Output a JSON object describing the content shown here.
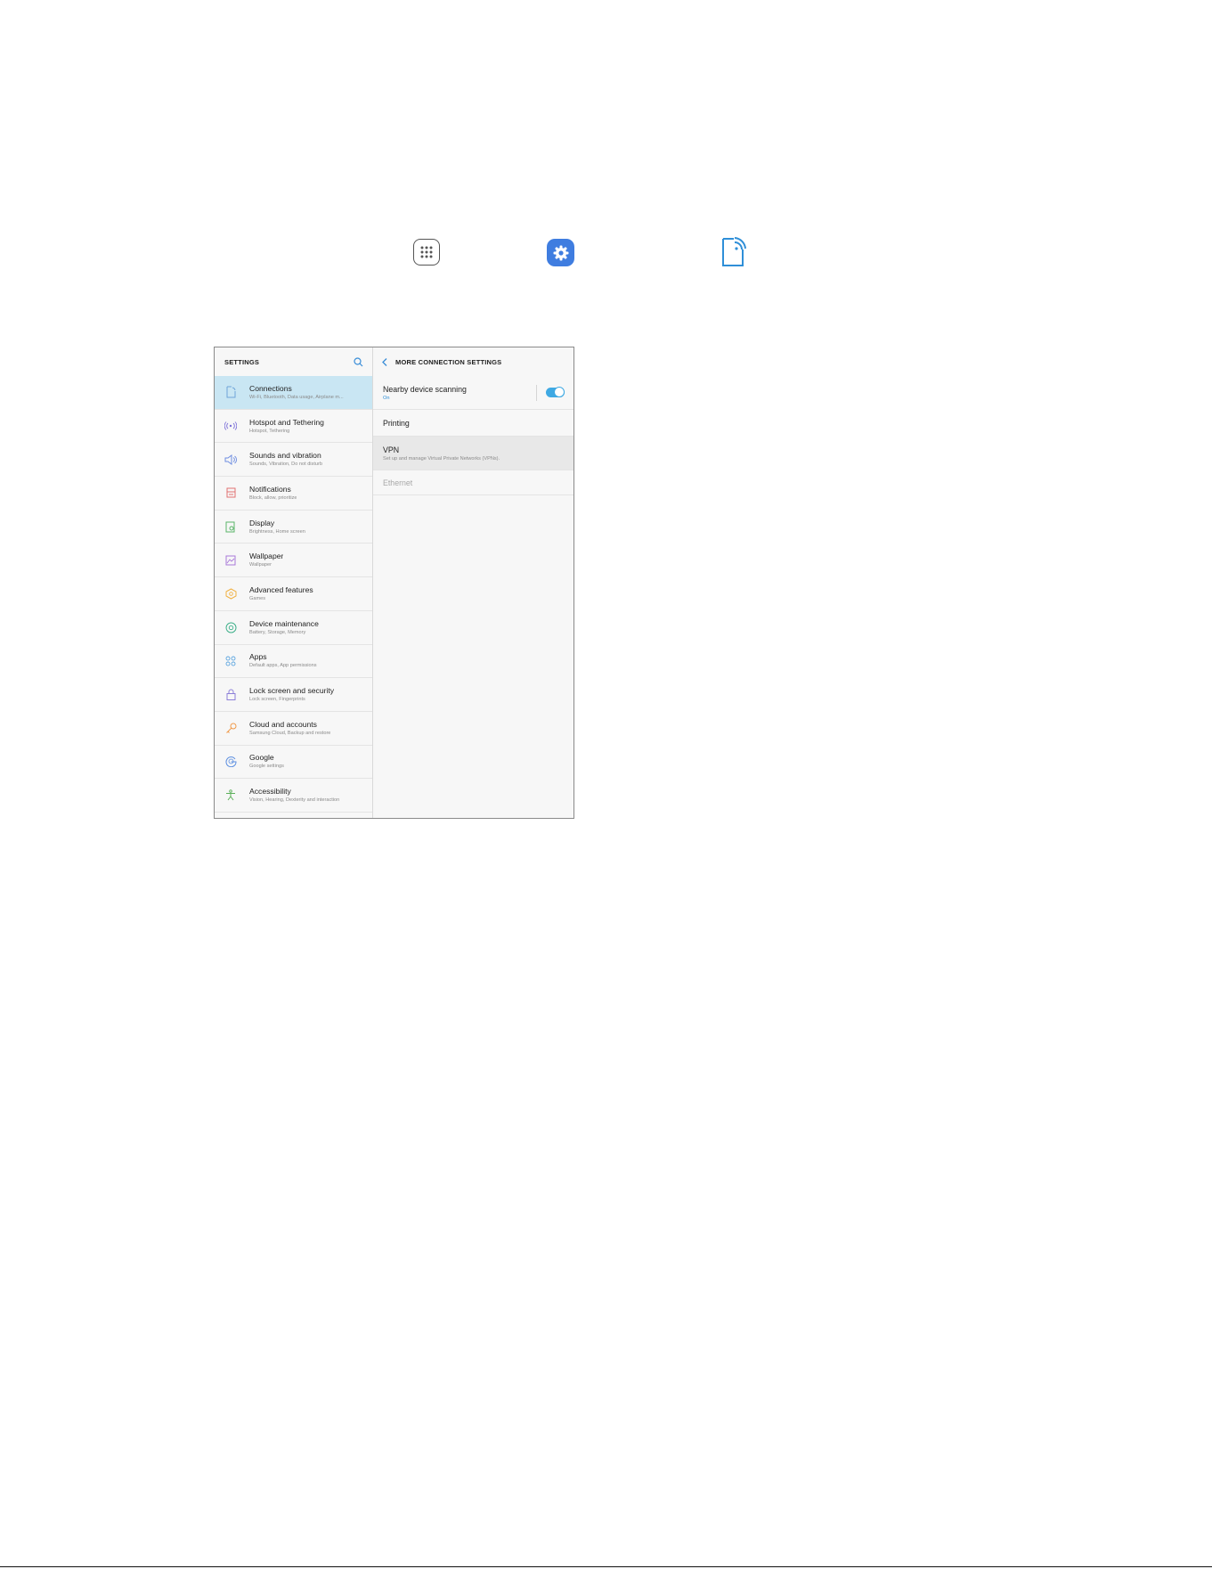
{
  "left_pane": {
    "header_title": "SETTINGS",
    "items": [
      {
        "title": "Connections",
        "subtitle": "Wi-Fi, Bluetooth, Data usage, Airplane m...",
        "icon": "connections-icon",
        "color": "#6ea4d8"
      },
      {
        "title": "Hotspot and Tethering",
        "subtitle": "Hotspot, Tethering",
        "icon": "hotspot-icon",
        "color": "#7b6fd8"
      },
      {
        "title": "Sounds and vibration",
        "subtitle": "Sounds, Vibration, Do not disturb",
        "icon": "speaker-icon",
        "color": "#6e8de0"
      },
      {
        "title": "Notifications",
        "subtitle": "Block, allow, prioritize",
        "icon": "notifications-icon",
        "color": "#e27272"
      },
      {
        "title": "Display",
        "subtitle": "Brightness, Home screen",
        "icon": "display-icon",
        "color": "#5bb56a"
      },
      {
        "title": "Wallpaper",
        "subtitle": "Wallpaper",
        "icon": "wallpaper-icon",
        "color": "#a878d8"
      },
      {
        "title": "Advanced features",
        "subtitle": "Games",
        "icon": "advanced-features-icon",
        "color": "#f0b040"
      },
      {
        "title": "Device maintenance",
        "subtitle": "Battery, Storage, Memory",
        "icon": "device-maintenance-icon",
        "color": "#3fb08a"
      },
      {
        "title": "Apps",
        "subtitle": "Default apps, App permissions",
        "icon": "apps-grid-icon",
        "color": "#5fa6e0"
      },
      {
        "title": "Lock screen and security",
        "subtitle": "Lock screen, Fingerprints",
        "icon": "lock-icon",
        "color": "#8c7fd8"
      },
      {
        "title": "Cloud and accounts",
        "subtitle": "Samsung Cloud, Backup and restore",
        "icon": "key-icon",
        "color": "#f09a4a"
      },
      {
        "title": "Google",
        "subtitle": "Google settings",
        "icon": "google-icon",
        "color": "#5b8ee0"
      },
      {
        "title": "Accessibility",
        "subtitle": "Vision, Hearing, Dexterity and interaction",
        "icon": "accessibility-icon",
        "color": "#5cb05a"
      }
    ]
  },
  "right_pane": {
    "header_title": "MORE CONNECTION SETTINGS",
    "nearby": {
      "title": "Nearby device scanning",
      "status": "On"
    },
    "printing": {
      "title": "Printing"
    },
    "vpn": {
      "title": "VPN",
      "subtitle": "Set up and manage Virtual Private Networks (VPNs)."
    },
    "ethernet": {
      "title": "Ethernet"
    }
  },
  "top_icons": [
    "apps-icon",
    "settings-icon",
    "connections-icon"
  ],
  "colors": {
    "accent": "#3fa9e3",
    "selected_row": "#c9e6f3",
    "settings_app": "#3f7de0"
  }
}
